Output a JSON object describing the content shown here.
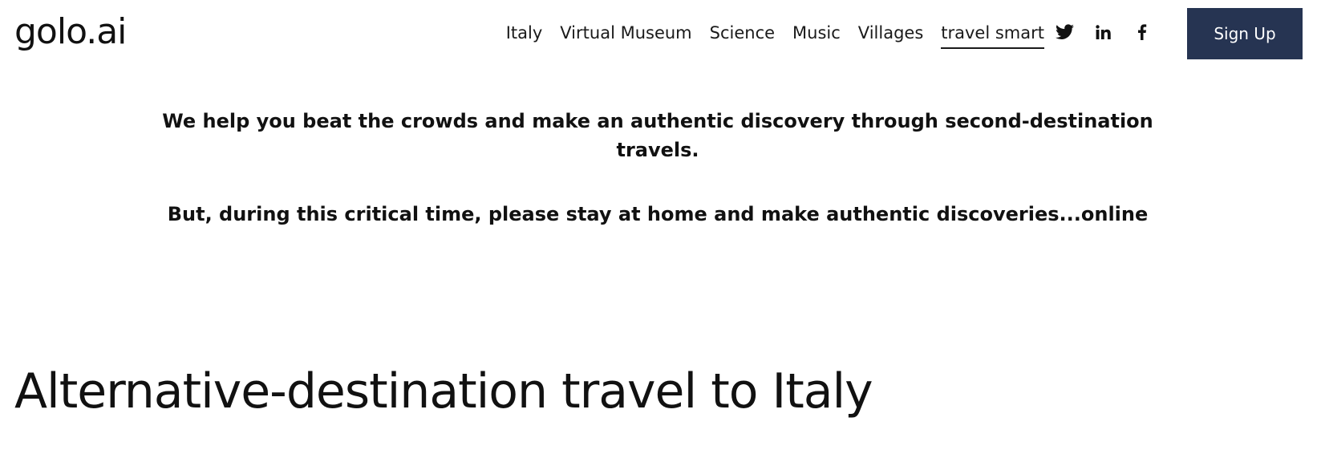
{
  "header": {
    "logo": "golo.ai",
    "nav": [
      {
        "label": "Italy"
      },
      {
        "label": "Virtual Museum"
      },
      {
        "label": "Science"
      },
      {
        "label": "Music"
      },
      {
        "label": "Villages"
      },
      {
        "label": "travel smart",
        "active": true
      }
    ],
    "social": [
      {
        "icon": "twitter-icon"
      },
      {
        "icon": "linkedin-icon"
      },
      {
        "icon": "facebook-icon"
      }
    ],
    "signup_label": "Sign Up"
  },
  "main": {
    "intro": "We help you beat the crowds and make an authentic discovery through second-destination travels.",
    "intro2": "But, during this critical time, please stay at home and make authentic discoveries...online",
    "headline": "Alternative-destination travel to Italy"
  },
  "colors": {
    "button_bg": "#263452",
    "text": "#111111",
    "background": "#ffffff"
  }
}
